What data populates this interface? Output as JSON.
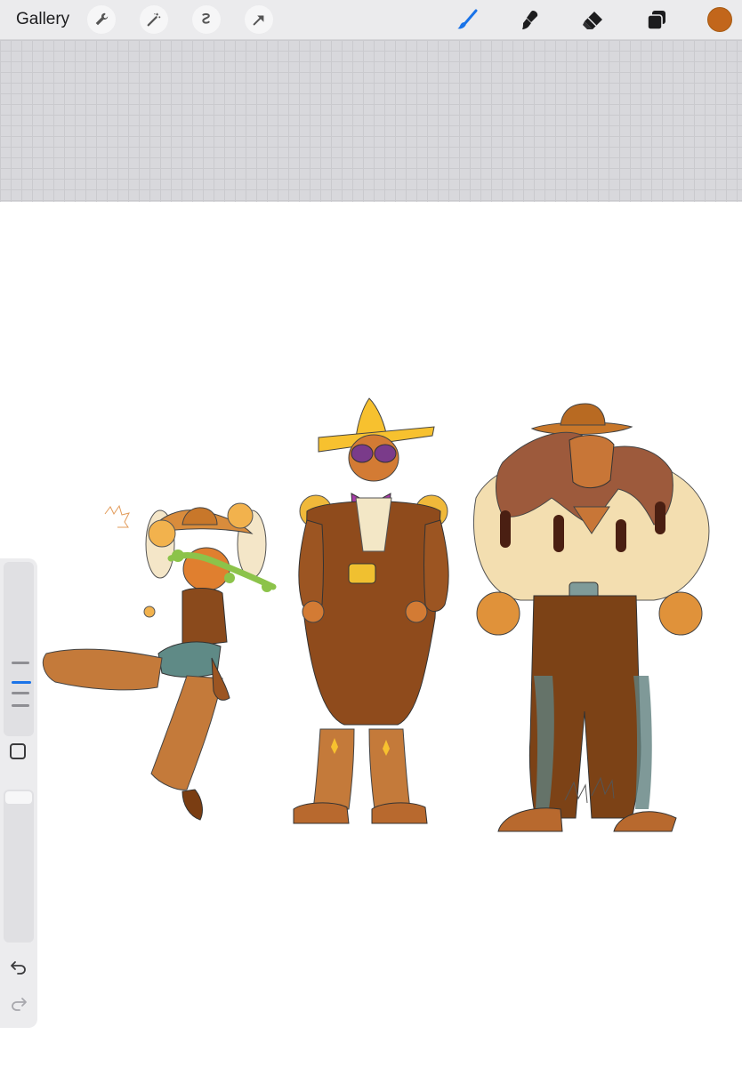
{
  "toolbar": {
    "gallery_label": "Gallery",
    "left_tools": [
      "wrench-icon",
      "magic-wand-icon",
      "selection-icon",
      "transform-arrow-icon"
    ],
    "right_tools": [
      "brush-icon",
      "smudge-icon",
      "eraser-icon",
      "layers-icon"
    ],
    "active_tool": "brush-icon",
    "active_color": "#c2661b"
  },
  "sidebar": {
    "controls": [
      "brush-size-slider",
      "modify-button",
      "opacity-slider",
      "undo-icon",
      "redo-icon"
    ]
  },
  "colors": {
    "accent": "#1a73e8",
    "swatch": "#c2661b"
  }
}
